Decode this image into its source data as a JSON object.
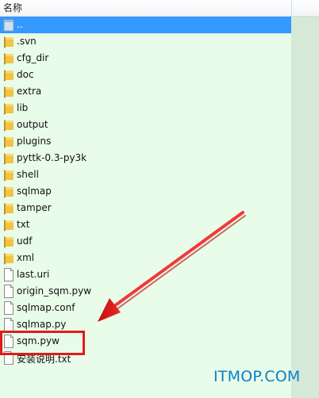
{
  "header": {
    "column_name": "名称"
  },
  "files": [
    {
      "name": "..",
      "type": "folder",
      "selected": true
    },
    {
      "name": ".svn",
      "type": "folder"
    },
    {
      "name": "cfg_dir",
      "type": "folder"
    },
    {
      "name": "doc",
      "type": "folder"
    },
    {
      "name": "extra",
      "type": "folder"
    },
    {
      "name": "lib",
      "type": "folder"
    },
    {
      "name": "output",
      "type": "folder"
    },
    {
      "name": "plugins",
      "type": "folder"
    },
    {
      "name": "pyttk-0.3-py3k",
      "type": "folder"
    },
    {
      "name": "shell",
      "type": "folder"
    },
    {
      "name": "sqlmap",
      "type": "folder"
    },
    {
      "name": "tamper",
      "type": "folder"
    },
    {
      "name": "txt",
      "type": "folder"
    },
    {
      "name": "udf",
      "type": "folder"
    },
    {
      "name": "xml",
      "type": "folder"
    },
    {
      "name": "last.uri",
      "type": "file"
    },
    {
      "name": "origin_sqm.pyw",
      "type": "file"
    },
    {
      "name": "sqlmap.conf",
      "type": "file"
    },
    {
      "name": "sqlmap.py",
      "type": "file"
    },
    {
      "name": "sqm.pyw",
      "type": "file",
      "highlighted": true
    },
    {
      "name": "安装说明.txt",
      "type": "file"
    }
  ],
  "watermark": "ITMOP.COM",
  "colors": {
    "list_background": "#e9fbe9",
    "selection": "#3399ff",
    "annotation": "#e01b1b",
    "watermark": "#0a82c7"
  }
}
